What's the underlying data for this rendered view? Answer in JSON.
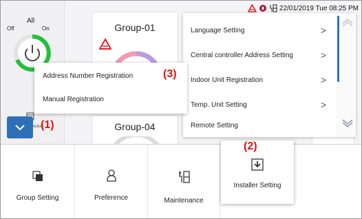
{
  "status_bar": {
    "datetime": "22/01/2019 Tue 08:25 PM"
  },
  "all_control": {
    "label": "All",
    "off_label": "Off",
    "on_label": "On"
  },
  "schedule": {
    "label": "Schedule"
  },
  "groups": [
    {
      "name": "Group-01"
    },
    {
      "name": "Group-04"
    }
  ],
  "installer_menu": {
    "items": [
      {
        "label": "Language Setting",
        "has_submenu": true
      },
      {
        "label": "Central controller Address Setting",
        "has_submenu": true
      },
      {
        "label": "Indoor Unit Registration",
        "has_submenu": true
      },
      {
        "label": "Temp. Unit Setting",
        "has_submenu": true
      },
      {
        "label": "Remote Setting",
        "has_submenu": false
      }
    ],
    "chevron": ">"
  },
  "registration_menu": {
    "items": [
      {
        "label": "Address Number Registration"
      },
      {
        "label": "Manual Registration"
      }
    ]
  },
  "bottom_bar": {
    "items": [
      {
        "label": "Group Setting",
        "icon": "group-setting-icon"
      },
      {
        "label": "Preference",
        "icon": "preference-icon"
      },
      {
        "label": "Maintenance",
        "icon": "maintenance-icon"
      },
      {
        "label": "Installer Setting",
        "icon": "installer-setting-icon",
        "selected": true
      }
    ]
  },
  "callouts": {
    "c1": "(1)",
    "c2": "(2)",
    "c3": "(3)"
  },
  "colors": {
    "accent_blue": "#2f6fb8",
    "callout_red": "#e01010",
    "power_green": "#22c03a",
    "alert_red": "#e02020"
  }
}
